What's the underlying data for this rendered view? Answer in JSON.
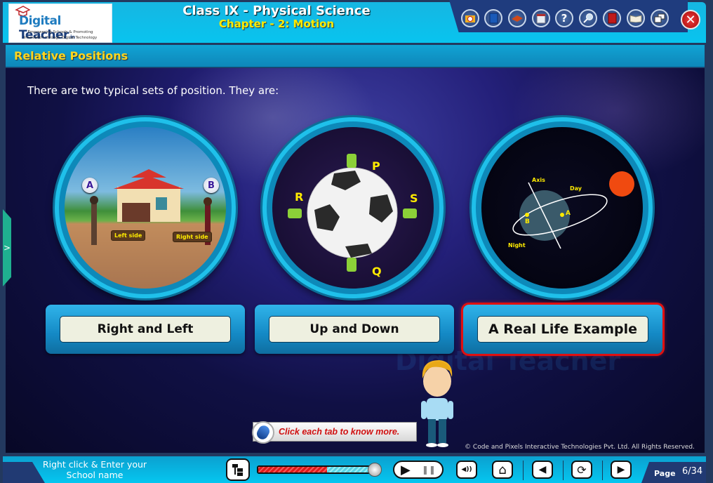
{
  "header": {
    "logo": {
      "brand_part1": "Digital",
      "brand_part2": "Teacher",
      "brand_suffix": ".in",
      "tagline_1": "Empowering Schools & Promoting",
      "tagline_2": "Innovation through Digital Technology"
    },
    "title": "Class IX - Physical Science",
    "subtitle": "Chapter - 2: Motion",
    "toolbar": [
      {
        "icon": "folder-clock-icon",
        "label": ""
      },
      {
        "icon": "notebook-icon",
        "label": ""
      },
      {
        "icon": "drawing-tablet-icon",
        "label": ""
      },
      {
        "icon": "whiteboard-icon",
        "label": ""
      },
      {
        "icon": "help-icon",
        "label": "?"
      },
      {
        "icon": "magnifier-icon",
        "label": ""
      },
      {
        "icon": "book-icon",
        "label": ""
      },
      {
        "icon": "open-book-icon",
        "label": ""
      },
      {
        "icon": "window-resize-icon",
        "label": ""
      }
    ],
    "close_symbol": "✕"
  },
  "section_title": "Relative Positions",
  "intro_text": "There are two typical sets of position. They are:",
  "circles": {
    "right_left": {
      "point_a": "A",
      "point_b": "B",
      "left_tag": "Left side",
      "right_tag": "Right side"
    },
    "up_down": {
      "p": "P",
      "q": "Q",
      "r": "R",
      "s": "S"
    },
    "real_life": {
      "axis": "Axis",
      "day": "Day",
      "night": "Night",
      "a": "A",
      "b": "B"
    }
  },
  "tabs": [
    {
      "label": "Right and Left",
      "selected": false
    },
    {
      "label": "Up and Down",
      "selected": false
    },
    {
      "label": "A Real Life Example",
      "selected": true
    }
  ],
  "hint": "Click each tab to know more.",
  "watermark": "Digital Teacher",
  "copyright": "© Code and Pixels Interactive Technologies  Pvt. Ltd. All Rights Reserved.",
  "side_tab_symbol": ">",
  "footer": {
    "school_name": "Right click & Enter your School name",
    "progress_fraction": 0.6,
    "play_symbol": "▶",
    "pause_symbol": "❚❚",
    "sound_symbol": "◀))",
    "home_symbol": "⌂",
    "prev_symbol": "◀",
    "replay_symbol": "⟳",
    "next_symbol": "▶",
    "page_label": "Page",
    "page_number": "6/34"
  }
}
